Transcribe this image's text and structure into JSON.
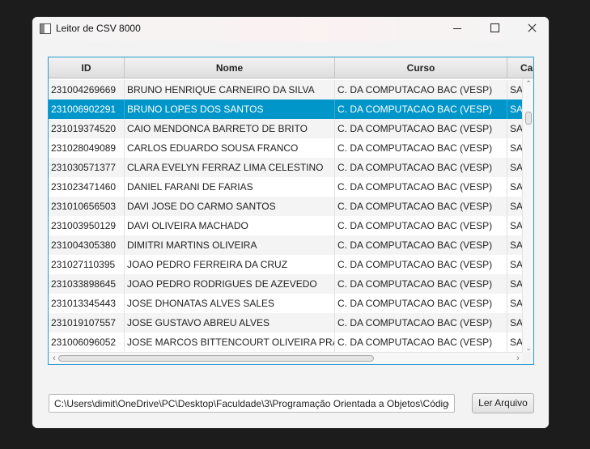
{
  "window": {
    "title": "Leitor de CSV 8000",
    "icon": "app-window-icon"
  },
  "table": {
    "columns": [
      "ID",
      "Nome",
      "Curso",
      "Car"
    ],
    "selected_index": 1,
    "rows": [
      [
        "231004269669",
        "BRUNO HENRIQUE CARNEIRO DA SILVA",
        "C. DA COMPUTACAO BAC (VESP)",
        "SAO"
      ],
      [
        "231006902291",
        "BRUNO LOPES DOS SANTOS",
        "C. DA COMPUTACAO BAC (VESP)",
        "SAO"
      ],
      [
        "231019374520",
        "CAIO MENDONCA BARRETO DE BRITO",
        "C. DA COMPUTACAO BAC (VESP)",
        "SAO"
      ],
      [
        "231028049089",
        "CARLOS EDUARDO SOUSA FRANCO",
        "C. DA COMPUTACAO BAC (VESP)",
        "SAO"
      ],
      [
        "231030571377",
        "CLARA EVELYN FERRAZ LIMA CELESTINO",
        "C. DA COMPUTACAO BAC (VESP)",
        "SAO"
      ],
      [
        "231023471460",
        "DANIEL FARANI DE FARIAS",
        "C. DA COMPUTACAO BAC (VESP)",
        "SAO"
      ],
      [
        "231010656503",
        "DAVI JOSE DO CARMO SANTOS",
        "C. DA COMPUTACAO BAC (VESP)",
        "SAO"
      ],
      [
        "231003950129",
        "DAVI OLIVEIRA MACHADO",
        "C. DA COMPUTACAO BAC (VESP)",
        "SAO"
      ],
      [
        "231004305380",
        "DIMITRI MARTINS OLIVEIRA",
        "C. DA COMPUTACAO BAC (VESP)",
        "SAO"
      ],
      [
        "231027110395",
        "JOAO PEDRO FERREIRA DA CRUZ",
        "C. DA COMPUTACAO BAC (VESP)",
        "SAO"
      ],
      [
        "231033898645",
        "JOAO PEDRO RODRIGUES DE AZEVEDO",
        "C. DA COMPUTACAO BAC (VESP)",
        "SAO"
      ],
      [
        "231013345443",
        "JOSE DHONATAS ALVES SALES",
        "C. DA COMPUTACAO BAC (VESP)",
        "SAO"
      ],
      [
        "231019107557",
        "JOSE GUSTAVO ABREU ALVES",
        "C. DA COMPUTACAO BAC (VESP)",
        "SAO"
      ],
      [
        "231006096052",
        "JOSE MARCOS BITTENCOURT OLIVEIRA PRADO",
        "C. DA COMPUTACAO BAC (VESP)",
        "SAO"
      ]
    ]
  },
  "footer": {
    "path_value": "C:\\Users\\dimit\\OneDrive\\PC\\Desktop\\Faculdade\\3\\Programação Orientada a Objetos\\Códigos",
    "read_button_label": "Ler Arquivo"
  },
  "colors": {
    "selection": "#0096c9",
    "focus_border": "#2b9ad1"
  }
}
